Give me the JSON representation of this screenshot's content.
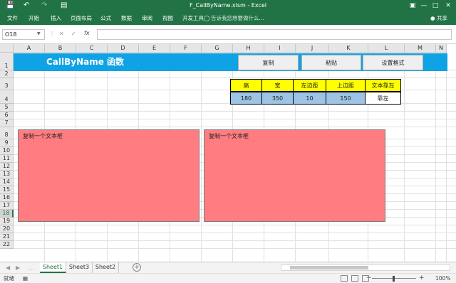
{
  "window": {
    "title": "F_CallByName.xlsm - Excel"
  },
  "quick_access": {
    "save_icon": "save-icon",
    "undo_icon": "undo-icon",
    "redo_icon": "redo-icon",
    "print_preview_icon": "print-preview-icon"
  },
  "ribbon": {
    "tabs": [
      "文件",
      "开始",
      "插入",
      "页面布局",
      "公式",
      "数据",
      "审阅",
      "视图",
      "开发工具"
    ],
    "tell_me": "告诉我您想要做什么...",
    "share": "共享"
  },
  "formula_bar": {
    "name_box": "O18",
    "value": ""
  },
  "columns": [
    "A",
    "B",
    "C",
    "D",
    "E",
    "F",
    "G",
    "H",
    "I",
    "J",
    "K",
    "L",
    "M",
    "N"
  ],
  "rows": [
    "1",
    "2",
    "3",
    "4",
    "5",
    "6",
    "7",
    "8",
    "9",
    "10",
    "11",
    "12",
    "13",
    "14",
    "15",
    "16",
    "17",
    "18",
    "19",
    "20",
    "21",
    "22"
  ],
  "selected_row": "18",
  "sheet": {
    "title": "CallByName 函数",
    "buttons": {
      "copy": "复制",
      "paste": "粘贴",
      "format": "设置格式"
    },
    "params_table": {
      "headers": [
        "高",
        "宽",
        "左边距",
        "上边距",
        "文本靠左"
      ],
      "values": [
        "180",
        "350",
        "10",
        "150",
        "靠左"
      ]
    },
    "textboxes": [
      "复制一个文本框",
      "复制一个文本框"
    ]
  },
  "sheet_tabs": [
    "Sheet1",
    "Sheet3",
    "Sheet2"
  ],
  "active_sheet": "Sheet1",
  "status": {
    "ready": "就绪",
    "zoom": "100%"
  },
  "colors": {
    "accent": "#217346",
    "banner": "#0fa2e4",
    "header_fill": "#ffff00",
    "value_fill": "#9dc3e6",
    "textbox_fill": "#ff7c80"
  }
}
